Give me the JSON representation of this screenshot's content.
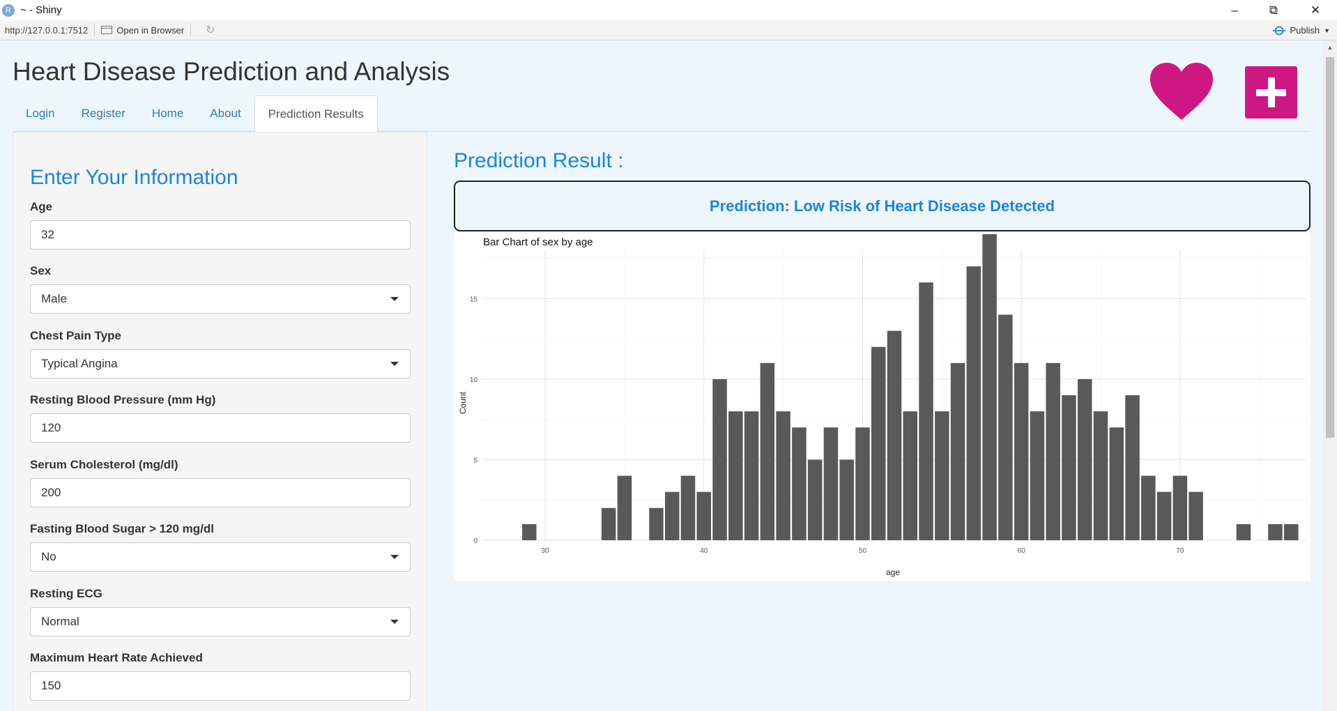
{
  "window": {
    "title": "~ - Shiny",
    "app_icon": "R"
  },
  "toolbar": {
    "url": "http://127.0.0.1:7512",
    "open_in_browser": "Open in Browser",
    "publish": "Publish"
  },
  "header": {
    "title": "Heart Disease Prediction and Analysis",
    "logo_color": "#cf1783"
  },
  "tabs": [
    {
      "label": "Login"
    },
    {
      "label": "Register"
    },
    {
      "label": "Home"
    },
    {
      "label": "About"
    },
    {
      "label": "Prediction Results",
      "active": true
    }
  ],
  "sidebar": {
    "heading": "Enter Your Information",
    "fields": [
      {
        "label": "Age",
        "value": "32",
        "type": "input"
      },
      {
        "label": "Sex",
        "value": "Male",
        "type": "select"
      },
      {
        "label": "Chest Pain Type",
        "value": "Typical Angina",
        "type": "select"
      },
      {
        "label": "Resting Blood Pressure (mm Hg)",
        "value": "120",
        "type": "input"
      },
      {
        "label": "Serum Cholesterol (mg/dl)",
        "value": "200",
        "type": "input"
      },
      {
        "label": "Fasting Blood Sugar > 120 mg/dl",
        "value": "No",
        "type": "select"
      },
      {
        "label": "Resting ECG",
        "value": "Normal",
        "type": "select"
      },
      {
        "label": "Maximum Heart Rate Achieved",
        "value": "150",
        "type": "input"
      }
    ]
  },
  "main": {
    "result_heading": "Prediction Result :",
    "prediction_text": "Prediction: Low Risk of Heart Disease Detected"
  },
  "chart_data": {
    "type": "bar",
    "title": "Bar Chart of sex by age",
    "xlabel": "age",
    "ylabel": "Count",
    "xlim": [
      26,
      78
    ],
    "ylim": [
      0,
      18
    ],
    "x_ticks": [
      30,
      40,
      50,
      60,
      70
    ],
    "y_ticks": [
      0,
      5,
      10,
      15
    ],
    "grid": true,
    "bar_color": "#595959",
    "x": [
      29,
      34,
      35,
      37,
      38,
      39,
      40,
      41,
      42,
      43,
      44,
      45,
      46,
      47,
      48,
      49,
      50,
      51,
      52,
      53,
      54,
      55,
      56,
      57,
      58,
      59,
      60,
      61,
      62,
      63,
      64,
      65,
      66,
      67,
      68,
      69,
      70,
      71,
      74,
      76,
      77
    ],
    "values": [
      1,
      2,
      4,
      2,
      3,
      4,
      3,
      10,
      8,
      8,
      11,
      8,
      7,
      5,
      7,
      5,
      7,
      12,
      13,
      8,
      16,
      8,
      11,
      17,
      19,
      14,
      11,
      8,
      11,
      9,
      10,
      8,
      7,
      9,
      4,
      3,
      4,
      3,
      1,
      1,
      1
    ]
  }
}
